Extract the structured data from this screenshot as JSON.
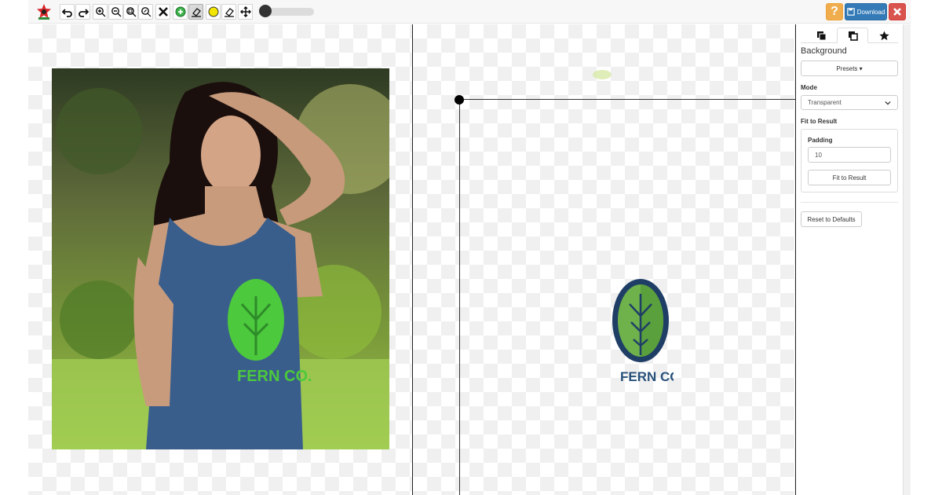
{
  "toolbar": {
    "icons": [
      "app-logo",
      "undo-icon",
      "redo-icon",
      "zoom-in-icon",
      "zoom-out-icon",
      "zoom-fit-icon",
      "zoom-actual-icon",
      "clear-icon",
      "keep-brush-icon",
      "eraser-icon",
      "hair-brush-icon",
      "eraser-alt-icon",
      "pan-icon"
    ],
    "help_label": "?",
    "download_label": "Download"
  },
  "side_panel": {
    "tabs": [
      "background-tab-icon",
      "crop-tab-icon",
      "effects-tab-icon"
    ],
    "active_tab": 1,
    "section_title": "Background",
    "presets_label": "Presets ▾",
    "mode_label": "Mode",
    "mode_value": "Transparent",
    "fit_section_label": "Fit to Result",
    "padding_label": "Padding",
    "padding_value": "10",
    "fit_button_label": "Fit to Result",
    "reset_button_label": "Reset to Defaults"
  },
  "colors": {
    "help": "#f0ad4e",
    "download": "#337ab7",
    "close": "#d9534f",
    "keep_green": "#3cb44b",
    "hair_yellow": "#f2e600"
  }
}
